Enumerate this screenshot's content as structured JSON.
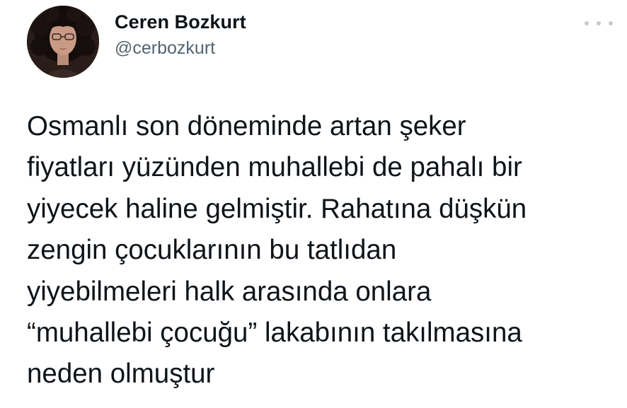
{
  "tweet": {
    "author": {
      "display_name": "Ceren Bozkurt",
      "handle": "@cerbozkurt"
    },
    "text_lines": [
      "Osmanlı son döneminde artan şeker",
      "fiyatları yüzünden muhallebi de pahalı bir",
      "yiyecek haline gelmiştir. Rahatına düşkün",
      "zengin çocuklarının bu tatlıdan",
      "yiyebilmeleri halk arasında onlara",
      "“muhallebi çocuğu” lakabının takılmasına",
      "neden olmuştur"
    ],
    "icons": {
      "avatar": "profile-photo",
      "more": "more-options-icon"
    },
    "colors": {
      "text": "#0f1419",
      "handle": "#536471",
      "background": "#ffffff"
    }
  }
}
